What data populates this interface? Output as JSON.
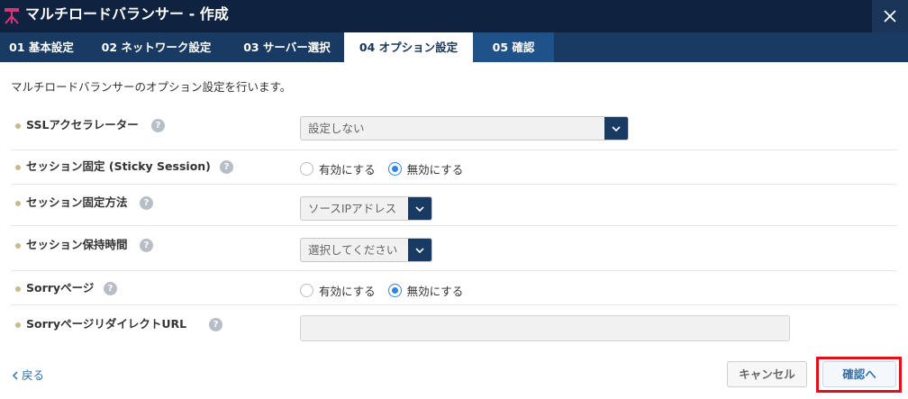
{
  "window": {
    "title": "マルチロードバランサー - 作成",
    "close_icon": "close-icon"
  },
  "tabs": [
    {
      "label": "01 基本設定"
    },
    {
      "label": "02 ネットワーク設定"
    },
    {
      "label": "03 サーバー選択"
    },
    {
      "label": "04 オプション設定",
      "active": true
    },
    {
      "label": "05 確認"
    }
  ],
  "intro": "マルチロードバランサーのオプション設定を行います。",
  "form": {
    "ssl_accelerator": {
      "label": "SSLアクセラレーター",
      "value": "設定しない"
    },
    "sticky_session": {
      "label": "セッション固定 (Sticky Session)",
      "options": [
        "有効にする",
        "無効にする"
      ],
      "selected": "無効にする"
    },
    "sticky_method": {
      "label": "セッション固定方法",
      "value": "ソースIPアドレス"
    },
    "session_timeout": {
      "label": "セッション保持時間",
      "value": "選択してください"
    },
    "sorry_page": {
      "label": "Sorryページ",
      "options": [
        "有効にする",
        "無効にする"
      ],
      "selected": "無効にする"
    },
    "sorry_redirect": {
      "label": "SorryページリダイレクトURL",
      "value": ""
    }
  },
  "footer": {
    "back": "戻る",
    "cancel": "キャンセル",
    "confirm": "確認へ"
  },
  "colors": {
    "titlebar": "#0f2340",
    "tabbar": "#183a63",
    "accent": "#2f86de",
    "highlight": "#e0101a"
  }
}
